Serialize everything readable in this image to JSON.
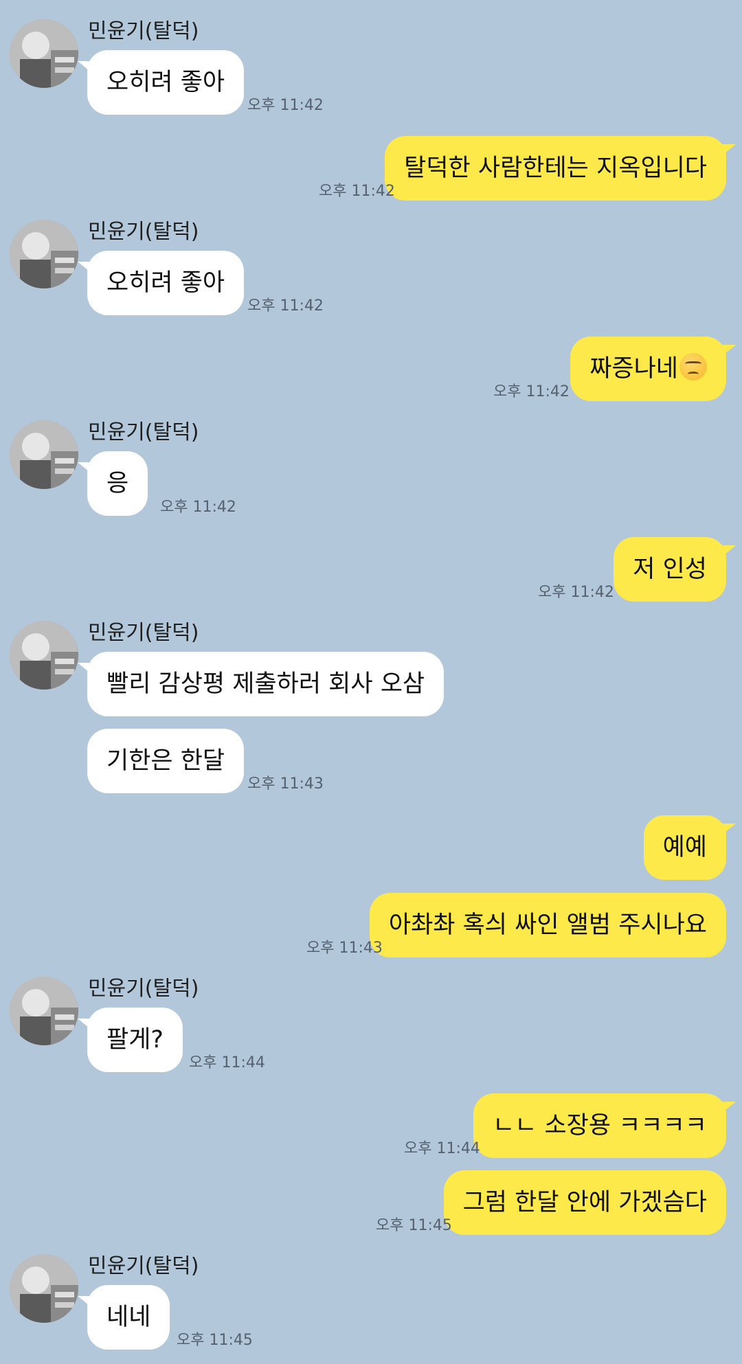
{
  "colors": {
    "background": "#b2c7da",
    "incoming_bubble": "#ffffff",
    "outgoing_bubble": "#fee94a"
  },
  "contact": {
    "name": "민윤기(탈덕)",
    "avatar_icon": "profile-photo-icon"
  },
  "messages": [
    {
      "sender": "contact",
      "text": "오히려 좋아",
      "time": "오후 11:42"
    },
    {
      "sender": "me",
      "text": "탈덕한 사람한테는 지옥입니다",
      "time": "오후 11:42"
    },
    {
      "sender": "contact",
      "text": "오히려 좋아",
      "time": "오후 11:42"
    },
    {
      "sender": "me",
      "text": "짜증나네",
      "emoji": "unamused-face-icon",
      "time": "오후 11:42"
    },
    {
      "sender": "contact",
      "text": "응",
      "time": "오후 11:42"
    },
    {
      "sender": "me",
      "text": "저 인성",
      "time": "오후 11:42"
    },
    {
      "sender": "contact",
      "text": "빨리 감상평 제출하러 회사 오삼",
      "time": ""
    },
    {
      "sender": "contact",
      "text": "기한은 한달",
      "time": "오후 11:43"
    },
    {
      "sender": "me",
      "text": "예예",
      "time": ""
    },
    {
      "sender": "me",
      "text": "아촤촤 혹싀 싸인 앨범 주시나요",
      "time": "오후 11:43"
    },
    {
      "sender": "contact",
      "text": "팔게?",
      "time": "오후 11:44"
    },
    {
      "sender": "me",
      "text": "ㄴㄴ 소장용 ㅋㅋㅋㅋ",
      "time": "오후 11:44"
    },
    {
      "sender": "me",
      "text": "그럼 한달 안에 가겠슴다",
      "time": "오후 11:45"
    },
    {
      "sender": "contact",
      "text": "네네",
      "time": "오후 11:45"
    }
  ]
}
